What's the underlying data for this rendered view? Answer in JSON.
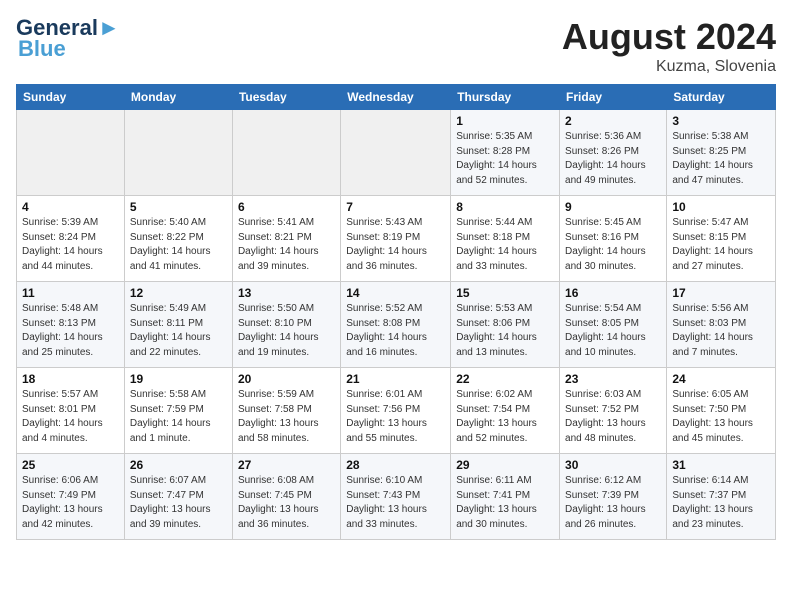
{
  "header": {
    "logo_line1": "General",
    "logo_line2": "Blue",
    "month_year": "August 2024",
    "location": "Kuzma, Slovenia"
  },
  "days_of_week": [
    "Sunday",
    "Monday",
    "Tuesday",
    "Wednesday",
    "Thursday",
    "Friday",
    "Saturday"
  ],
  "weeks": [
    [
      {
        "day": "",
        "text": ""
      },
      {
        "day": "",
        "text": ""
      },
      {
        "day": "",
        "text": ""
      },
      {
        "day": "",
        "text": ""
      },
      {
        "day": "1",
        "text": "Sunrise: 5:35 AM\nSunset: 8:28 PM\nDaylight: 14 hours and 52 minutes."
      },
      {
        "day": "2",
        "text": "Sunrise: 5:36 AM\nSunset: 8:26 PM\nDaylight: 14 hours and 49 minutes."
      },
      {
        "day": "3",
        "text": "Sunrise: 5:38 AM\nSunset: 8:25 PM\nDaylight: 14 hours and 47 minutes."
      }
    ],
    [
      {
        "day": "4",
        "text": "Sunrise: 5:39 AM\nSunset: 8:24 PM\nDaylight: 14 hours and 44 minutes."
      },
      {
        "day": "5",
        "text": "Sunrise: 5:40 AM\nSunset: 8:22 PM\nDaylight: 14 hours and 41 minutes."
      },
      {
        "day": "6",
        "text": "Sunrise: 5:41 AM\nSunset: 8:21 PM\nDaylight: 14 hours and 39 minutes."
      },
      {
        "day": "7",
        "text": "Sunrise: 5:43 AM\nSunset: 8:19 PM\nDaylight: 14 hours and 36 minutes."
      },
      {
        "day": "8",
        "text": "Sunrise: 5:44 AM\nSunset: 8:18 PM\nDaylight: 14 hours and 33 minutes."
      },
      {
        "day": "9",
        "text": "Sunrise: 5:45 AM\nSunset: 8:16 PM\nDaylight: 14 hours and 30 minutes."
      },
      {
        "day": "10",
        "text": "Sunrise: 5:47 AM\nSunset: 8:15 PM\nDaylight: 14 hours and 27 minutes."
      }
    ],
    [
      {
        "day": "11",
        "text": "Sunrise: 5:48 AM\nSunset: 8:13 PM\nDaylight: 14 hours and 25 minutes."
      },
      {
        "day": "12",
        "text": "Sunrise: 5:49 AM\nSunset: 8:11 PM\nDaylight: 14 hours and 22 minutes."
      },
      {
        "day": "13",
        "text": "Sunrise: 5:50 AM\nSunset: 8:10 PM\nDaylight: 14 hours and 19 minutes."
      },
      {
        "day": "14",
        "text": "Sunrise: 5:52 AM\nSunset: 8:08 PM\nDaylight: 14 hours and 16 minutes."
      },
      {
        "day": "15",
        "text": "Sunrise: 5:53 AM\nSunset: 8:06 PM\nDaylight: 14 hours and 13 minutes."
      },
      {
        "day": "16",
        "text": "Sunrise: 5:54 AM\nSunset: 8:05 PM\nDaylight: 14 hours and 10 minutes."
      },
      {
        "day": "17",
        "text": "Sunrise: 5:56 AM\nSunset: 8:03 PM\nDaylight: 14 hours and 7 minutes."
      }
    ],
    [
      {
        "day": "18",
        "text": "Sunrise: 5:57 AM\nSunset: 8:01 PM\nDaylight: 14 hours and 4 minutes."
      },
      {
        "day": "19",
        "text": "Sunrise: 5:58 AM\nSunset: 7:59 PM\nDaylight: 14 hours and 1 minute."
      },
      {
        "day": "20",
        "text": "Sunrise: 5:59 AM\nSunset: 7:58 PM\nDaylight: 13 hours and 58 minutes."
      },
      {
        "day": "21",
        "text": "Sunrise: 6:01 AM\nSunset: 7:56 PM\nDaylight: 13 hours and 55 minutes."
      },
      {
        "day": "22",
        "text": "Sunrise: 6:02 AM\nSunset: 7:54 PM\nDaylight: 13 hours and 52 minutes."
      },
      {
        "day": "23",
        "text": "Sunrise: 6:03 AM\nSunset: 7:52 PM\nDaylight: 13 hours and 48 minutes."
      },
      {
        "day": "24",
        "text": "Sunrise: 6:05 AM\nSunset: 7:50 PM\nDaylight: 13 hours and 45 minutes."
      }
    ],
    [
      {
        "day": "25",
        "text": "Sunrise: 6:06 AM\nSunset: 7:49 PM\nDaylight: 13 hours and 42 minutes."
      },
      {
        "day": "26",
        "text": "Sunrise: 6:07 AM\nSunset: 7:47 PM\nDaylight: 13 hours and 39 minutes."
      },
      {
        "day": "27",
        "text": "Sunrise: 6:08 AM\nSunset: 7:45 PM\nDaylight: 13 hours and 36 minutes."
      },
      {
        "day": "28",
        "text": "Sunrise: 6:10 AM\nSunset: 7:43 PM\nDaylight: 13 hours and 33 minutes."
      },
      {
        "day": "29",
        "text": "Sunrise: 6:11 AM\nSunset: 7:41 PM\nDaylight: 13 hours and 30 minutes."
      },
      {
        "day": "30",
        "text": "Sunrise: 6:12 AM\nSunset: 7:39 PM\nDaylight: 13 hours and 26 minutes."
      },
      {
        "day": "31",
        "text": "Sunrise: 6:14 AM\nSunset: 7:37 PM\nDaylight: 13 hours and 23 minutes."
      }
    ]
  ]
}
